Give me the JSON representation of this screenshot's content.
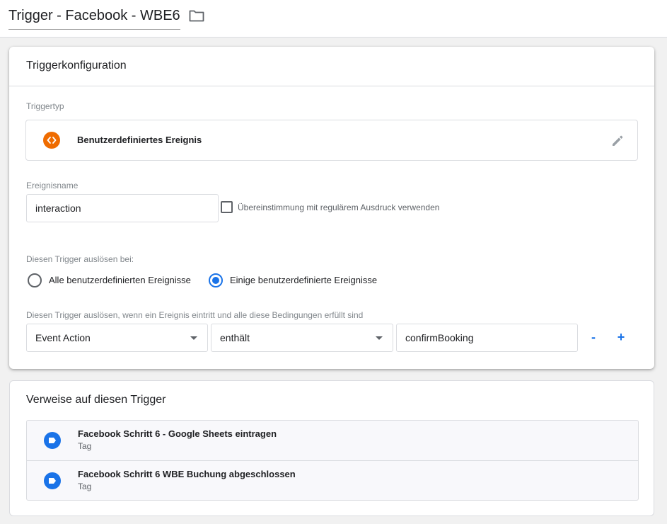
{
  "header": {
    "title": "Trigger - Facebook - WBE6"
  },
  "config": {
    "title": "Triggerkonfiguration",
    "triggertype_label": "Triggertyp",
    "triggertype_value": "Benutzerdefiniertes Ereignis",
    "eventname_label": "Ereignisname",
    "eventname_value": "interaction",
    "regex_label": "Übereinstimmung mit regulärem Ausdruck verwenden",
    "fire_on_label": "Diesen Trigger auslösen bei:",
    "radio_all_label": "Alle benutzerdefinierten Ereignisse",
    "radio_some_label": "Einige benutzerdefinierte Ereignisse",
    "conditions_label": "Diesen Trigger auslösen, wenn ein Ereignis eintritt und alle diese Bedingungen erfüllt sind",
    "condition": {
      "variable": "Event Action",
      "operator": "enthält",
      "value": "confirmBooking",
      "remove_label": "-",
      "add_label": "+"
    }
  },
  "references": {
    "title": "Verweise auf diesen Trigger",
    "items": [
      {
        "title": "Facebook Schritt 6 - Google Sheets eintragen",
        "type": "Tag"
      },
      {
        "title": "Facebook Schritt 6 WBE Buchung abgeschlossen",
        "type": "Tag"
      }
    ]
  },
  "colors": {
    "accent": "#1a73e8",
    "triggertype_icon": "#ef6c00"
  },
  "icons": {
    "folder": "folder-icon",
    "edit": "pencil-icon",
    "triggertype": "code-brackets-icon",
    "tag": "tag-icon"
  }
}
